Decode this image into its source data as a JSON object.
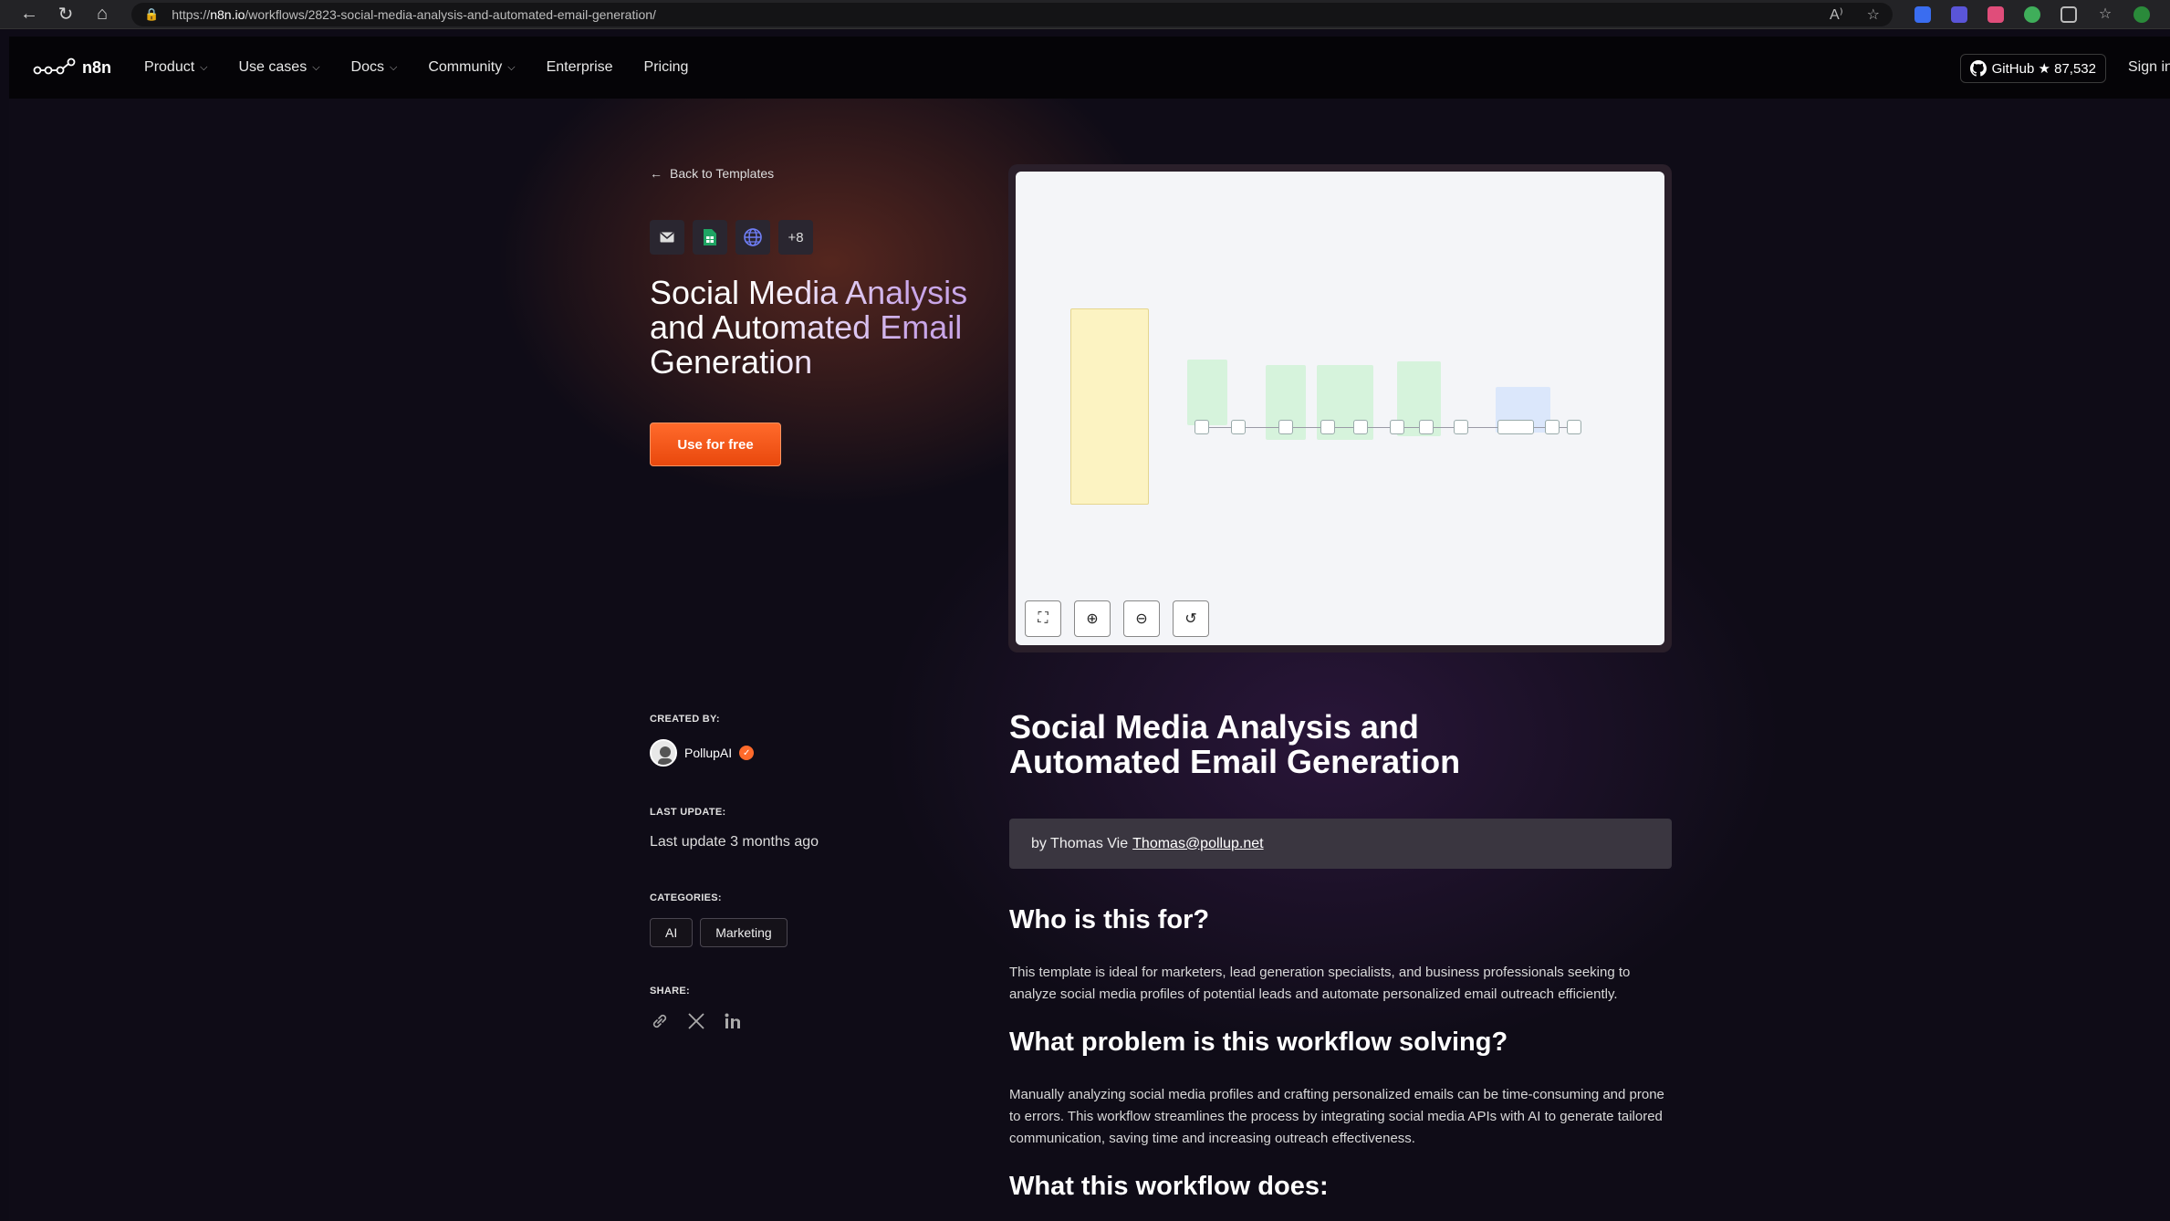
{
  "browser": {
    "url_scheme": "https://",
    "url_host": "n8n.io",
    "url_path": "/workflows/2823-social-media-analysis-and-automated-email-generation/"
  },
  "header": {
    "logo_text": "n8n",
    "menu": [
      "Product",
      "Use cases",
      "Docs",
      "Community",
      "Enterprise",
      "Pricing"
    ],
    "github_label": "GitHub ★ 87,532",
    "signin_label": "Sign in"
  },
  "template": {
    "back_label": "Back to Templates",
    "node_icons": [
      "email-icon",
      "google-sheets-icon",
      "http-globe-icon"
    ],
    "extra_nodes": "+8",
    "title": "Social Media Analysis and Automated Email Generation",
    "use_button": "Use for free",
    "created_by_label": "CREATED BY:",
    "author": "PollupAI",
    "last_update_label": "LAST UPDATE:",
    "last_update": "Last update 3 months ago",
    "categories_label": "CATEGORIES:",
    "categories": [
      "AI",
      "Marketing"
    ],
    "share_label": "SHARE:"
  },
  "content": {
    "heading": "Social Media Analysis and Automated Email Generation",
    "byline_prefix": "by Thomas Vie",
    "byline_email": "Thomas@pollup.net",
    "sections": [
      {
        "heading": "Who is this for?",
        "text": "This template is ideal for marketers, lead generation specialists, and business professionals seeking to analyze social media profiles of potential leads and automate personalized email outreach efficiently."
      },
      {
        "heading": "What problem is this workflow solving?",
        "text": "Manually analyzing social media profiles and crafting personalized emails can be time-consuming and prone to errors. This workflow streamlines the process by integrating social media APIs with AI to generate tailored communication, saving time and increasing outreach effectiveness."
      },
      {
        "heading": "What this workflow does:",
        "text": ""
      }
    ]
  },
  "colors": {
    "accent": "#ff6a2b",
    "background": "#0e0b16",
    "canvas": "#f4f5f8"
  }
}
